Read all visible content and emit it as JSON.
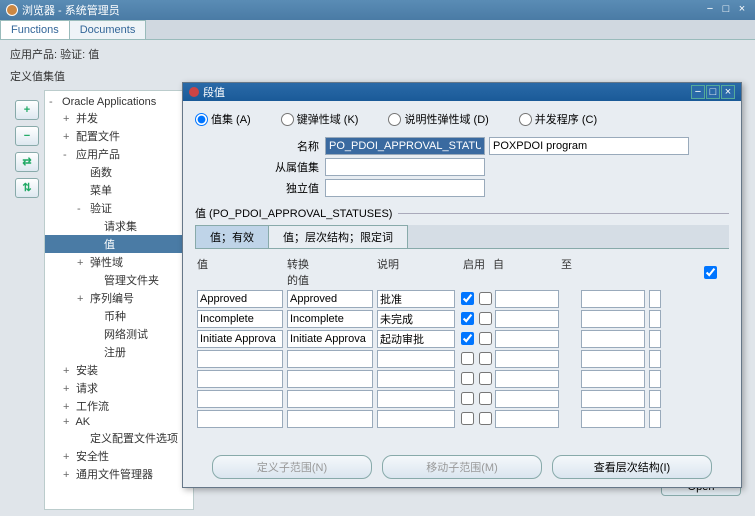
{
  "window": {
    "title": "浏览器 - 系统管理员"
  },
  "tabs": {
    "functions": "Functions",
    "documents": "Documents",
    "active": "Functions"
  },
  "path1": "应用产品: 验证: 值",
  "path2": "定义值集值",
  "side_buttons": [
    "+",
    "−",
    "⇄",
    "⇅"
  ],
  "tree": [
    {
      "exp": "-",
      "indent": 0,
      "label": "Oracle Applications"
    },
    {
      "exp": "+",
      "indent": 1,
      "label": "并发"
    },
    {
      "exp": "+",
      "indent": 1,
      "label": "配置文件"
    },
    {
      "exp": "-",
      "indent": 1,
      "label": "应用产品"
    },
    {
      "exp": "",
      "indent": 2,
      "label": "函数"
    },
    {
      "exp": "",
      "indent": 2,
      "label": "菜单"
    },
    {
      "exp": "-",
      "indent": 2,
      "label": "验证"
    },
    {
      "exp": "",
      "indent": 3,
      "label": "请求集"
    },
    {
      "exp": "",
      "indent": 3,
      "label": "值",
      "sel": true
    },
    {
      "exp": "+",
      "indent": 2,
      "label": "弹性域"
    },
    {
      "exp": "",
      "indent": 3,
      "label": "管理文件夹"
    },
    {
      "exp": "+",
      "indent": 2,
      "label": "序列编号"
    },
    {
      "exp": "",
      "indent": 3,
      "label": "币种"
    },
    {
      "exp": "",
      "indent": 3,
      "label": "网络测试"
    },
    {
      "exp": "",
      "indent": 3,
      "label": "注册"
    },
    {
      "exp": "+",
      "indent": 1,
      "label": "安装"
    },
    {
      "exp": "+",
      "indent": 1,
      "label": "请求"
    },
    {
      "exp": "+",
      "indent": 1,
      "label": "工作流"
    },
    {
      "exp": "+",
      "indent": 1,
      "label": "AK"
    },
    {
      "exp": "",
      "indent": 2,
      "label": "定义配置文件选项"
    },
    {
      "exp": "+",
      "indent": 1,
      "label": "安全性"
    },
    {
      "exp": "+",
      "indent": 1,
      "label": "通用文件管理器"
    }
  ],
  "dialog": {
    "title": "段值",
    "radios": {
      "valueset": "值集 (A)",
      "keyflex": "键弹性域 (K)",
      "descflex": "说明性弹性域 (D)",
      "concprog": "并发程序 (C)",
      "selected": "valueset"
    },
    "form": {
      "name_lbl": "名称",
      "name_val": "PO_PDOI_APPROVAL_STATUS",
      "name_desc": "POXPDOI program",
      "parent_lbl": "从属值集",
      "parent_val": "",
      "indep_lbl": "独立值",
      "indep_val": ""
    },
    "group_label": "值 (PO_PDOI_APPROVAL_STATUSES)",
    "group_checked": true,
    "inner_tabs": {
      "t1": "值；有效",
      "t2": "值；层次结构；限定词",
      "active": "t1"
    },
    "grid": {
      "headers": {
        "value": "值",
        "conv": "转换\n的值",
        "desc": "说明",
        "enabled": "启用",
        "from": "自",
        "to": "至"
      },
      "rows": [
        {
          "value": "Approved",
          "conv": "Approved",
          "desc": "批准",
          "enabled": true
        },
        {
          "value": "Incomplete",
          "conv": "Incomplete",
          "desc": "未完成",
          "enabled": true
        },
        {
          "value": "Initiate Approva",
          "conv": "Initiate Approva",
          "desc": "起动审批",
          "enabled": true
        },
        {
          "value": "",
          "conv": "",
          "desc": "",
          "enabled": false
        },
        {
          "value": "",
          "conv": "",
          "desc": "",
          "enabled": false
        },
        {
          "value": "",
          "conv": "",
          "desc": "",
          "enabled": false
        },
        {
          "value": "",
          "conv": "",
          "desc": "",
          "enabled": false
        }
      ]
    },
    "buttons": {
      "define_sub": "定义子范围(N)",
      "move_sub": "移动子范围(M)",
      "view_hier": "查看层次结构(I)"
    }
  },
  "open_btn": "Open"
}
